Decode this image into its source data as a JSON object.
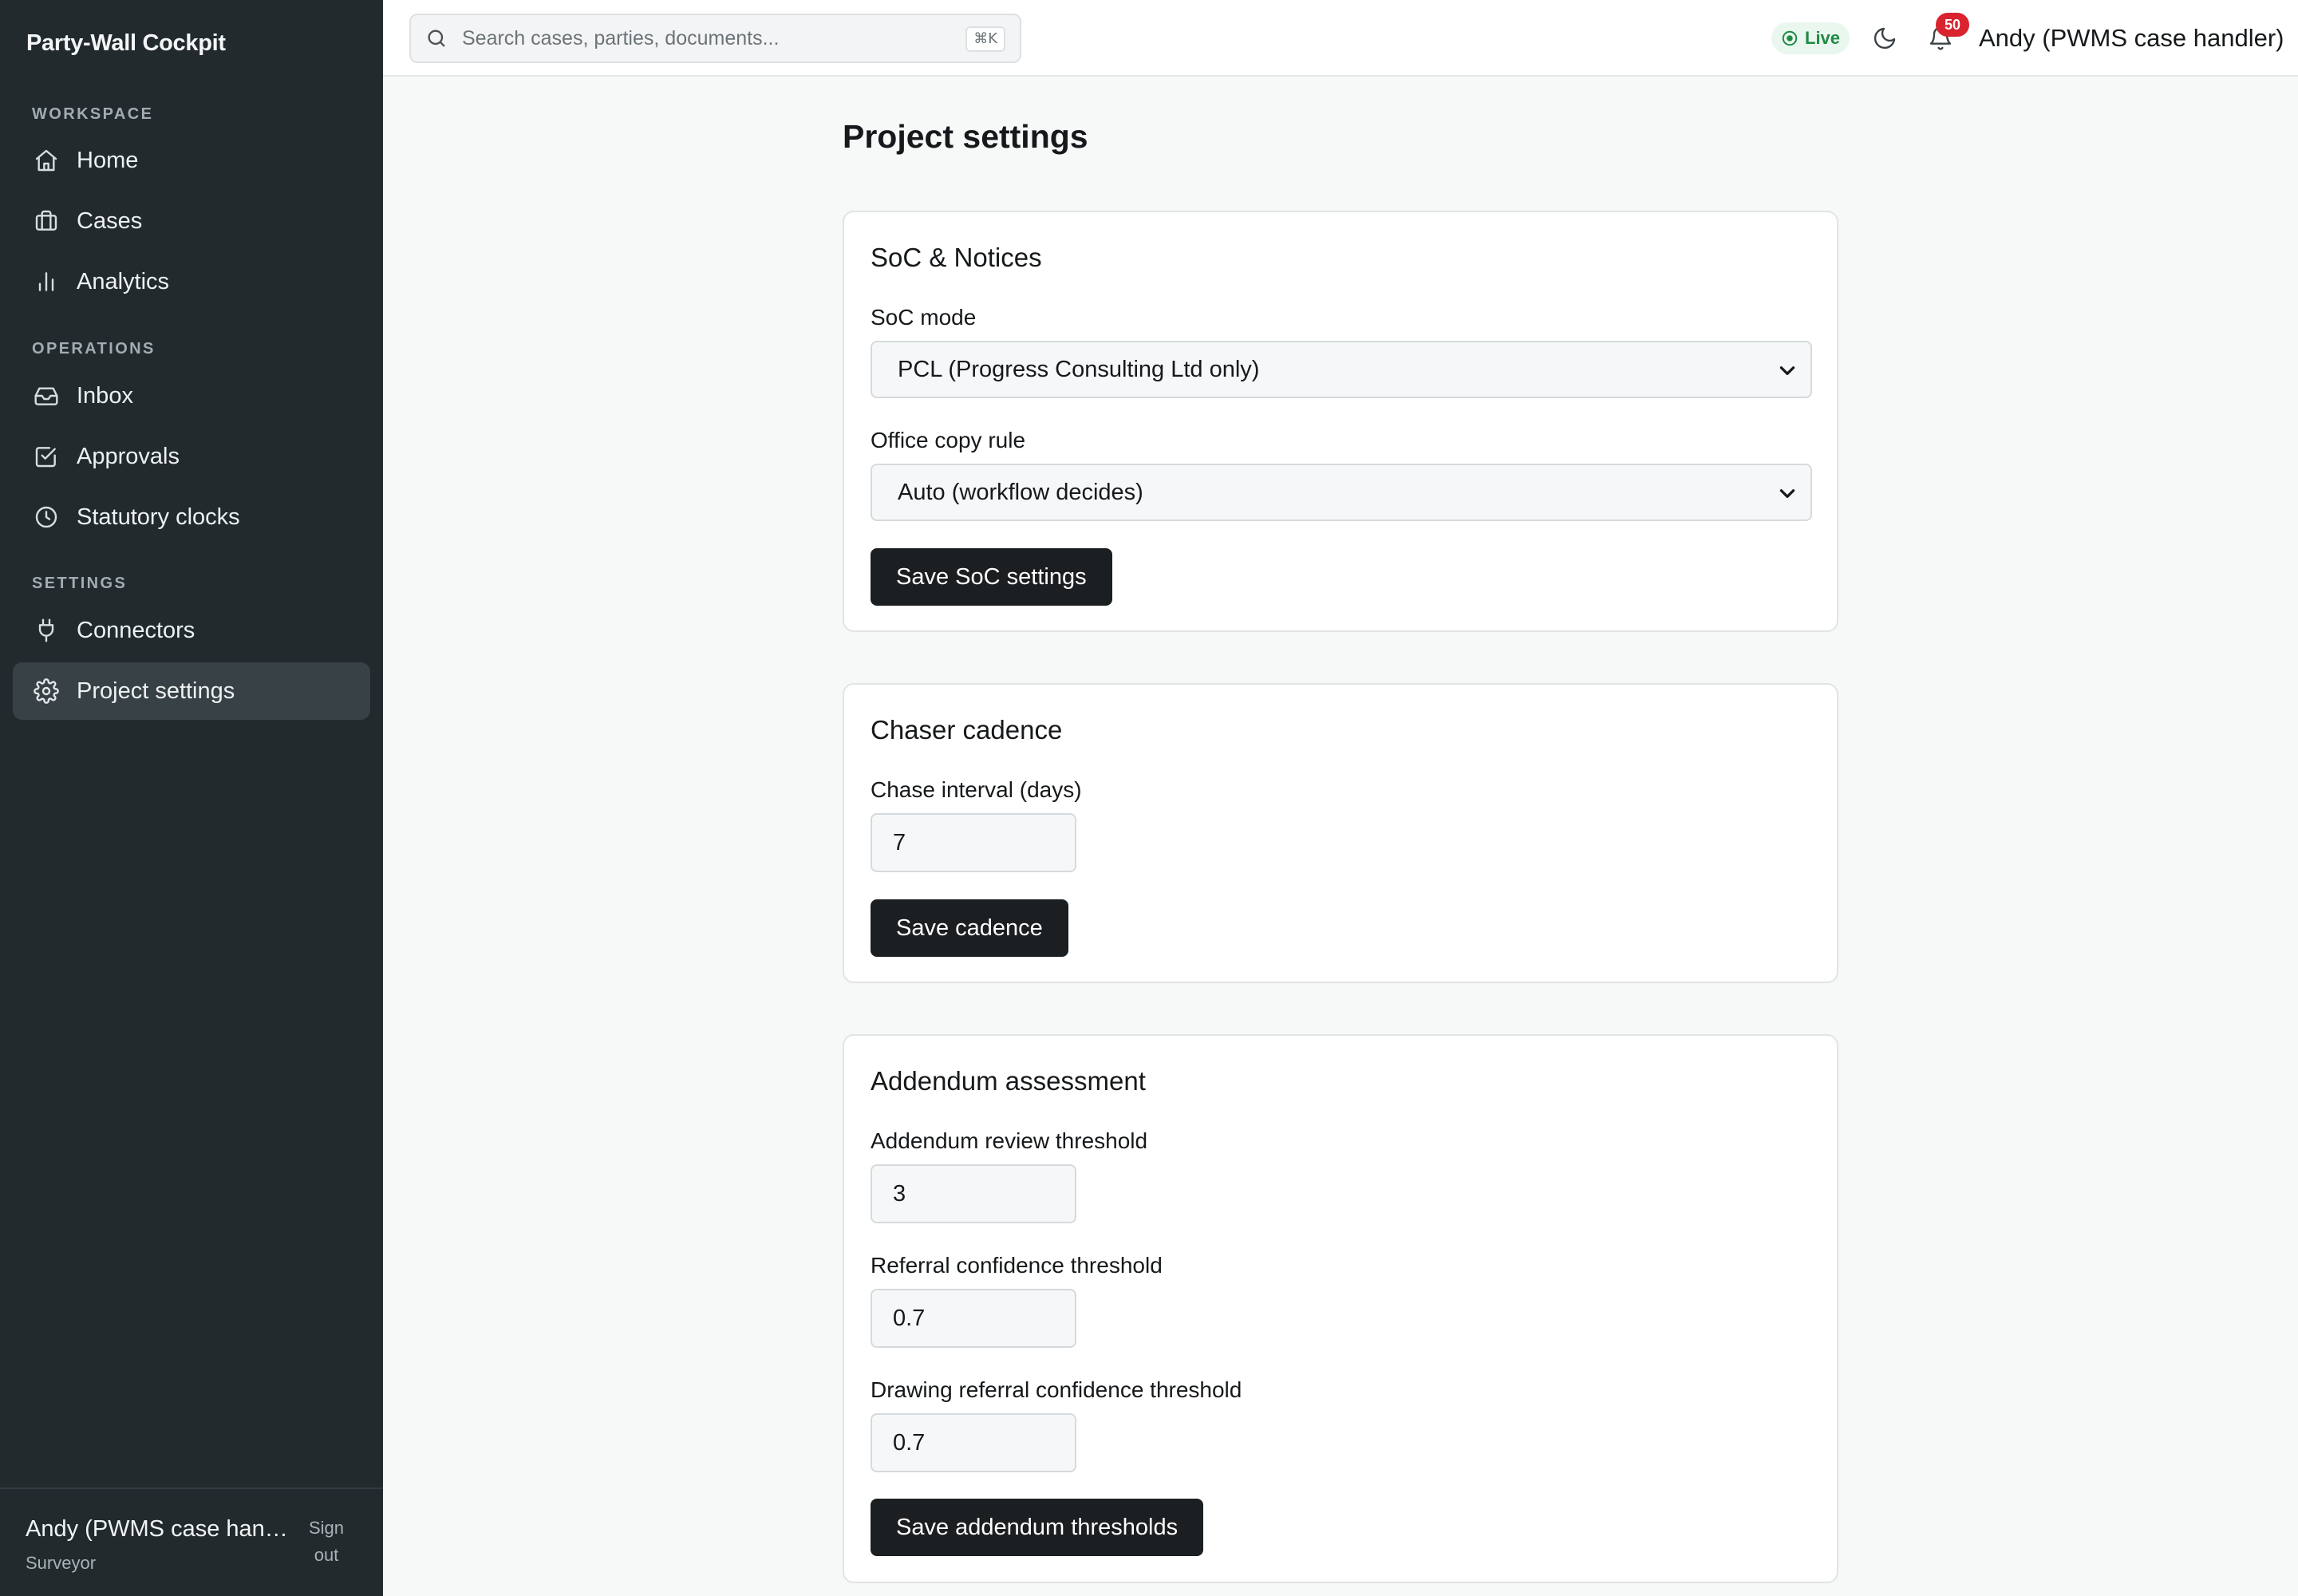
{
  "app": {
    "title": "Party-Wall Cockpit"
  },
  "sidebar": {
    "sections": [
      {
        "label": "WORKSPACE"
      },
      {
        "label": "OPERATIONS"
      },
      {
        "label": "SETTINGS"
      }
    ],
    "items": [
      {
        "label": "Home",
        "icon": "home-icon"
      },
      {
        "label": "Cases",
        "icon": "briefcase-icon"
      },
      {
        "label": "Analytics",
        "icon": "bar-chart-icon"
      },
      {
        "label": "Inbox",
        "icon": "inbox-icon"
      },
      {
        "label": "Approvals",
        "icon": "check-square-icon"
      },
      {
        "label": "Statutory clocks",
        "icon": "clock-icon"
      },
      {
        "label": "Connectors",
        "icon": "plug-icon"
      },
      {
        "label": "Project settings",
        "icon": "gear-icon",
        "active": true
      }
    ],
    "footer": {
      "name": "Andy (PWMS case handler)",
      "role": "Surveyor",
      "signout": "Sign out"
    }
  },
  "topbar": {
    "search": {
      "placeholder": "Search cases, parties, documents...",
      "shortcut": "⌘K"
    },
    "live": "Live",
    "notifications": "50",
    "user": "Andy (PWMS case handler)"
  },
  "main": {
    "title": "Project settings",
    "soc": {
      "title": "SoC & Notices",
      "mode_label": "SoC mode",
      "mode_value": "PCL (Progress Consulting Ltd only)",
      "copy_label": "Office copy rule",
      "copy_value": "Auto (workflow decides)",
      "save": "Save SoC settings"
    },
    "chaser": {
      "title": "Chaser cadence",
      "interval_label": "Chase interval (days)",
      "interval_value": "7",
      "save": "Save cadence"
    },
    "addendum": {
      "title": "Addendum assessment",
      "review_label": "Addendum review threshold",
      "review_value": "3",
      "referral_label": "Referral confidence threshold",
      "referral_value": "0.7",
      "drawing_label": "Drawing referral confidence threshold",
      "drawing_value": "0.7",
      "save": "Save addendum thresholds"
    }
  },
  "colors": {
    "sidebar_bg": "#222a2d",
    "active_item_bg": "#384145",
    "primary_button": "#1b1f21",
    "live_green": "#1f8a46",
    "badge_red": "#d9232e"
  }
}
